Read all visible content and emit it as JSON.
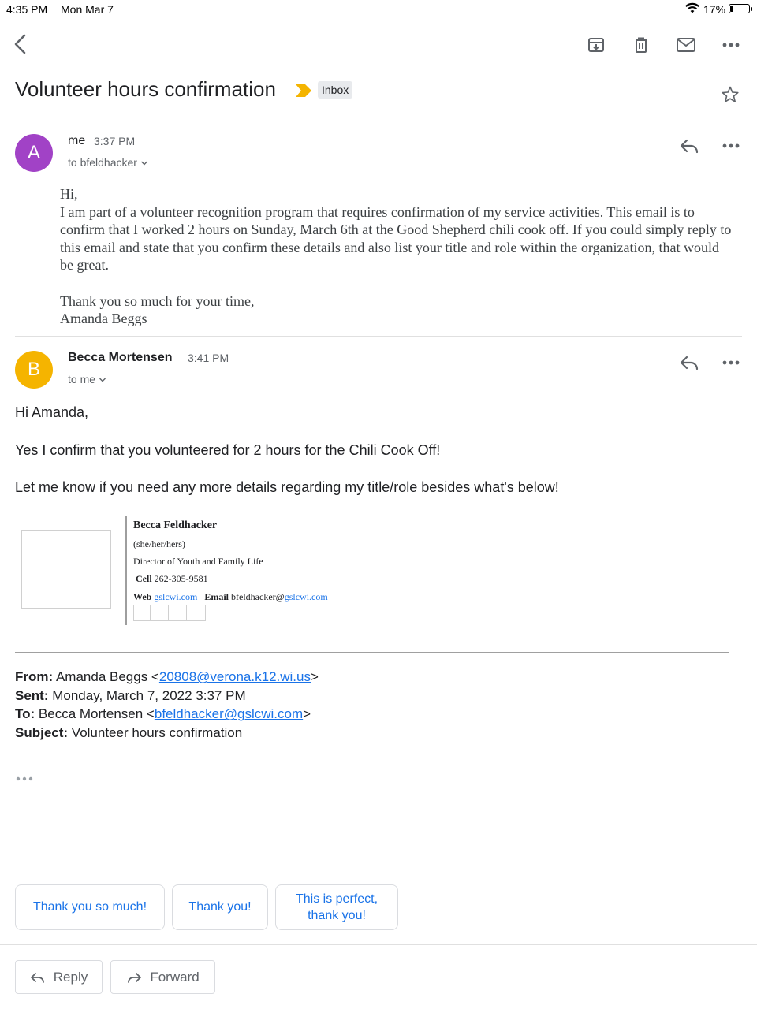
{
  "status_bar": {
    "time": "4:35 PM",
    "date": "Mon Mar 7",
    "battery": "17%",
    "battery_level": 0.17
  },
  "toolbar": {
    "back_icon": "back-arrow-icon",
    "archive_icon": "archive-icon",
    "delete_icon": "trash-icon",
    "mark_unread_icon": "mail-icon",
    "more_icon": "more-horizontal-icon"
  },
  "thread": {
    "subject": "Volunteer hours confirmation",
    "label": "Inbox",
    "label_color": "#f4b400"
  },
  "messages": [
    {
      "avatar_letter": "A",
      "avatar_color": "#a142c6",
      "sender": "me",
      "time": "3:37 PM",
      "recipient_line": "to bfeldhacker",
      "body_greeting": "Hi,",
      "body_paragraph": "I am part of a volunteer recognition program that requires confirmation of my service activities. This email is to confirm that I worked 2 hours on Sunday, March 6th at the Good Shepherd chili cook off. If you could simply reply to this email and state that you confirm these details and also list your title and role within the organization, that would be great.",
      "body_closing": "Thank you so much for your time,",
      "body_signoff": "Amanda Beggs"
    },
    {
      "avatar_letter": "B",
      "avatar_color": "#f5b400",
      "sender": "Becca Mortensen",
      "time": "3:41 PM",
      "recipient_line": "to me",
      "greeting": "Hi Amanda,",
      "line1": "Yes I confirm that you volunteered for 2 hours for the Chili Cook Off!",
      "line2": "Let me know if you need any more details regarding my title/role besides what's below!",
      "signature": {
        "name": "Becca Feldhacker",
        "pronouns": "(she/her/hers)",
        "title": "Director of Youth and Family Life",
        "cell_label": "Cell",
        "cell": "262-305-9581",
        "web_label": "Web",
        "web": "gslcwi.com",
        "email_label": "Email",
        "email_user": "bfeldhacker@",
        "email_domain": "gslcwi.com"
      },
      "quoted": {
        "from_label": "From:",
        "from_name": "Amanda Beggs <",
        "from_email": "20808@verona.k12.wi.us",
        "from_close": ">",
        "sent_label": "Sent:",
        "sent": "Monday, March 7, 2022 3:37 PM",
        "to_label": "To:",
        "to_name": "Becca Mortensen <",
        "to_email": "bfeldhacker@gslcwi.com",
        "to_close": ">",
        "subject_label": "Subject:",
        "subject": "Volunteer hours confirmation"
      }
    }
  ],
  "smart_replies": [
    "Thank you so much!",
    "Thank you!",
    "This is perfect, thank you!"
  ],
  "actions": {
    "reply": "Reply",
    "forward": "Forward"
  }
}
